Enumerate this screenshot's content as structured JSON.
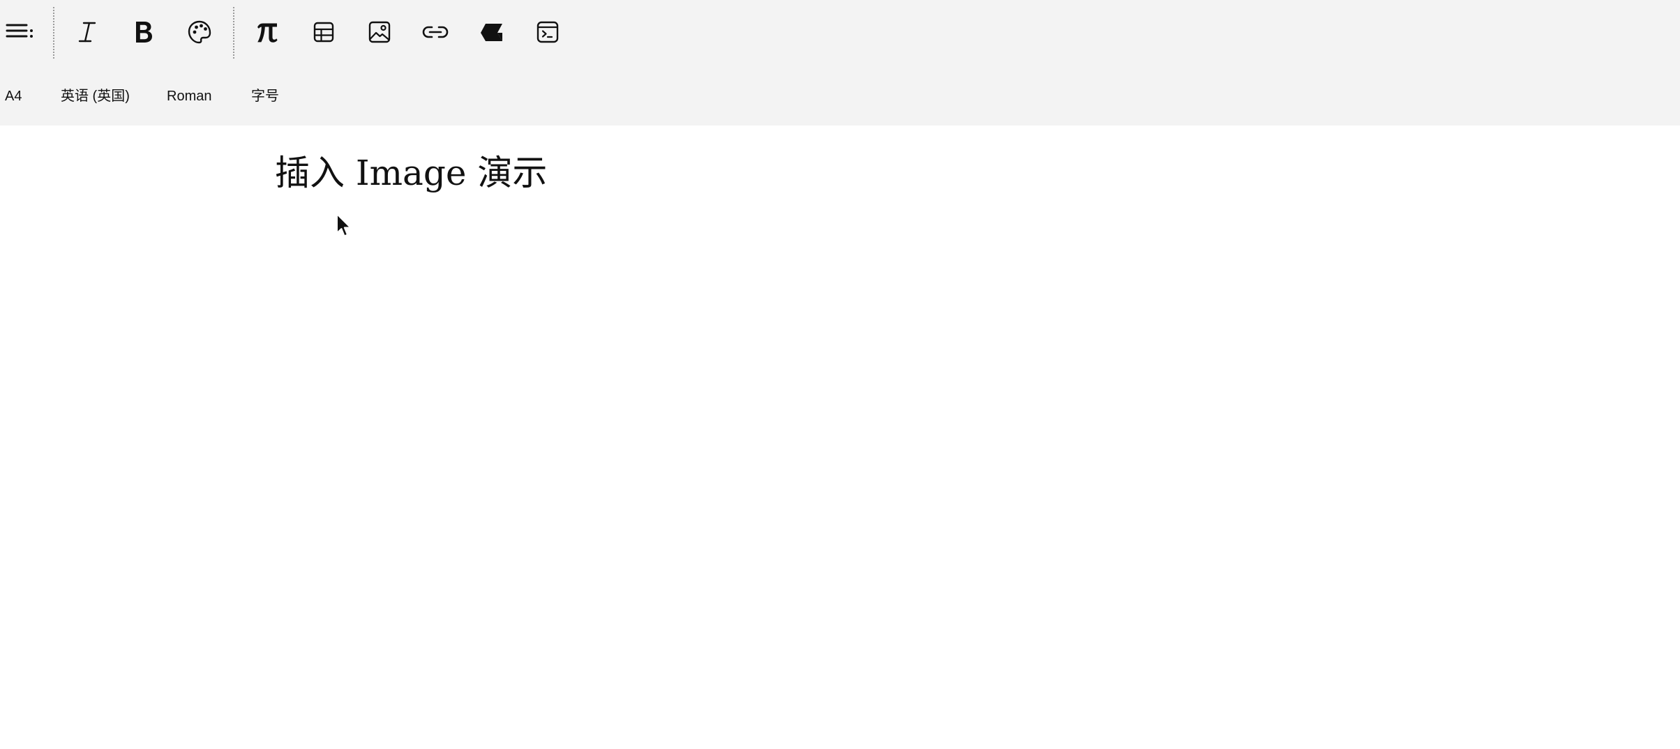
{
  "toolbar": {
    "buttons": [
      {
        "name": "outline-menu",
        "icon": "list-menu-icon",
        "tooltip": ""
      },
      {
        "name": "italic",
        "icon": "italic-icon",
        "tooltip": ""
      },
      {
        "name": "bold",
        "icon": "bold-icon",
        "tooltip": ""
      },
      {
        "name": "color",
        "icon": "palette-icon",
        "tooltip": ""
      },
      {
        "name": "math",
        "icon": "pi-icon",
        "tooltip": ""
      },
      {
        "name": "table",
        "icon": "table-icon",
        "tooltip": ""
      },
      {
        "name": "image",
        "icon": "image-icon",
        "tooltip": ""
      },
      {
        "name": "link",
        "icon": "link-icon",
        "tooltip": ""
      },
      {
        "name": "tag",
        "icon": "tag-icon",
        "tooltip": ""
      },
      {
        "name": "code",
        "icon": "terminal-icon",
        "tooltip": ""
      }
    ]
  },
  "status_bar": {
    "paper_size": "A4",
    "language": "英语 (英国)",
    "font": "Roman",
    "font_size": "字号"
  },
  "document": {
    "title": "插入 Image 演示"
  }
}
